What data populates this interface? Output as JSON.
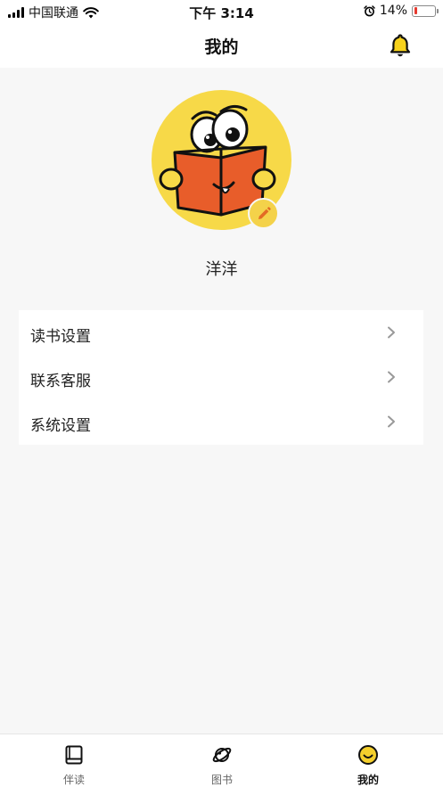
{
  "status_bar": {
    "carrier": "中国联通",
    "time": "下午 3:14",
    "battery_percent": "14%",
    "battery_level": 0.14,
    "battery_color": "#e63a2f"
  },
  "header": {
    "title": "我的",
    "right_icon": "bell-icon"
  },
  "profile": {
    "avatar": "book-reader-mascot",
    "edit_icon": "pencil-icon",
    "username": "洋洋"
  },
  "menu": {
    "items": [
      {
        "label": "读书设置",
        "icon": "chevron-right-icon"
      },
      {
        "label": "联系客服",
        "icon": "chevron-right-icon"
      },
      {
        "label": "系统设置",
        "icon": "chevron-right-icon"
      }
    ]
  },
  "tabs": [
    {
      "label": "伴读",
      "icon": "book-icon",
      "active": false
    },
    {
      "label": "图书",
      "icon": "planet-icon",
      "active": false
    },
    {
      "label": "我的",
      "icon": "smiley-icon",
      "active": true
    }
  ],
  "colors": {
    "accent_yellow": "#f4cf2c",
    "book_orange": "#e85d2a",
    "background": "#f7f7f7"
  }
}
